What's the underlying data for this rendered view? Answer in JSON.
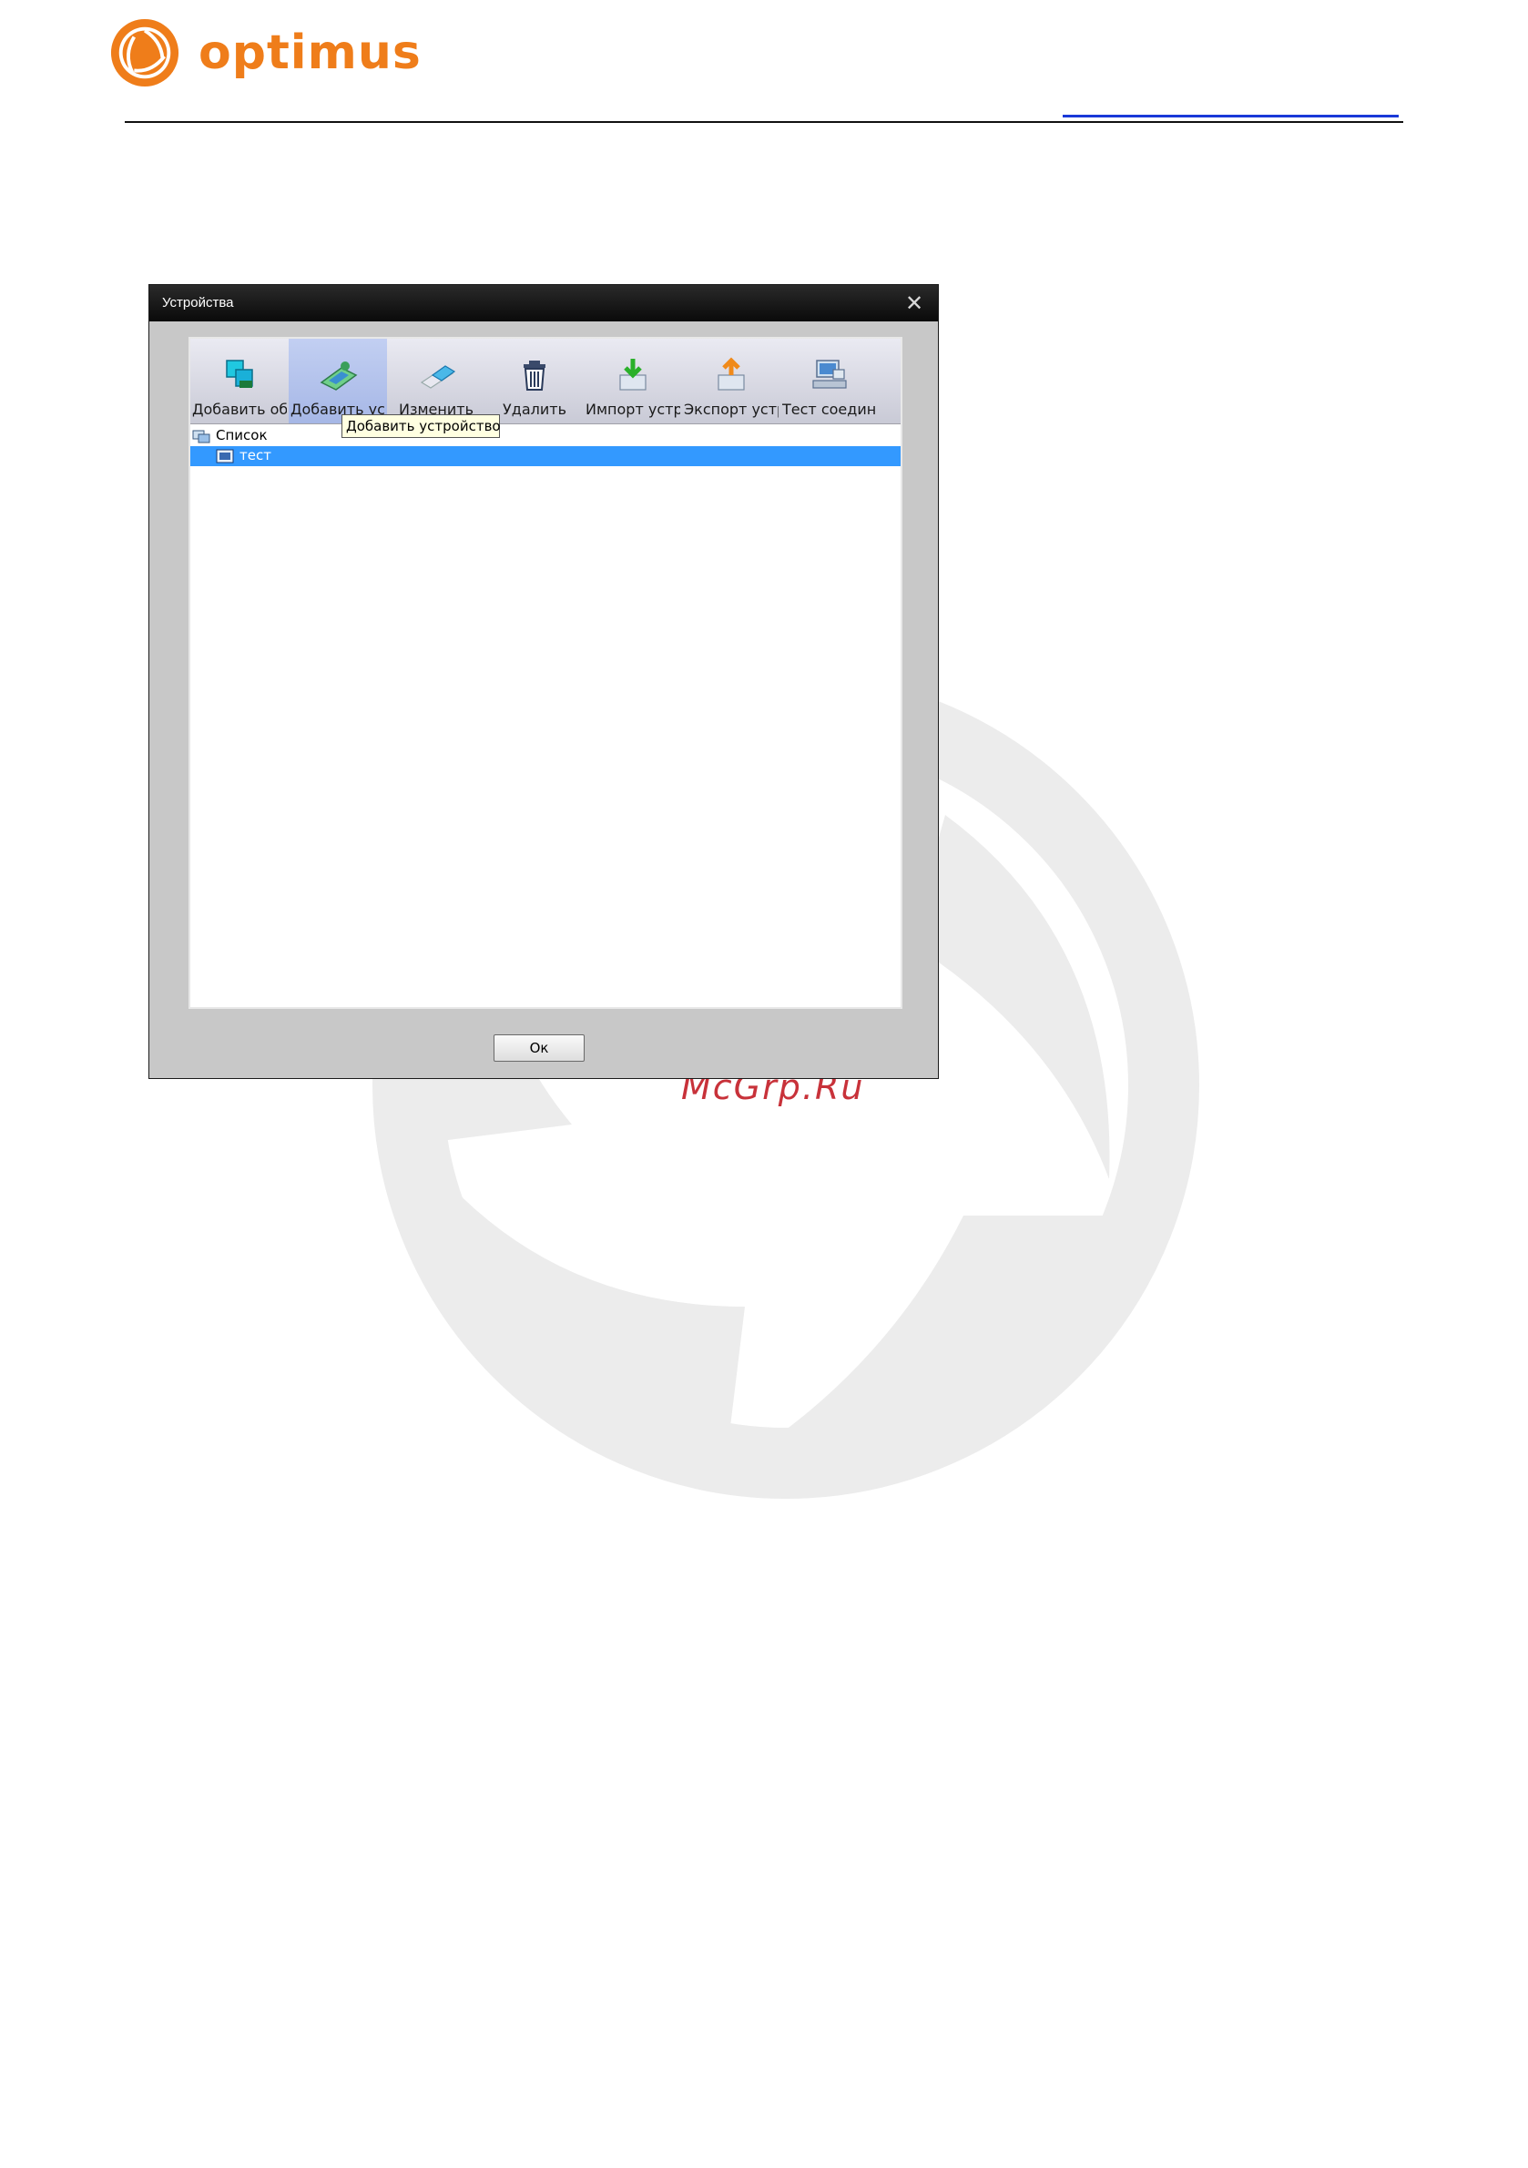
{
  "header": {
    "brand_name": "optimus",
    "brand_color": "#ef7d1a",
    "logo_icon": "aperture-logo-icon"
  },
  "watermark": {
    "text": "McGrp.Ru",
    "icon": "aperture-watermark-icon"
  },
  "dialog": {
    "title": "Устройства",
    "close_icon": "close-icon",
    "toolbar": {
      "buttons": [
        {
          "label": "Добавить обл",
          "icon": "add-area-icon"
        },
        {
          "label": "Добавить устр",
          "icon": "add-device-icon",
          "active": true
        },
        {
          "label": "Изменить",
          "icon": "edit-icon"
        },
        {
          "label": "Удалить",
          "icon": "trash-icon"
        },
        {
          "label": "Импорт устро",
          "icon": "import-icon"
        },
        {
          "label": "Экспорт устр",
          "icon": "export-icon"
        },
        {
          "label": "Тест соединени",
          "icon": "test-connection-icon"
        }
      ],
      "tooltip": "Добавить устройство"
    },
    "tree": {
      "root_label": "Список",
      "items": [
        {
          "label": "тест",
          "selected": true
        }
      ]
    },
    "ok_label": "Ок",
    "selection_color": "#3399ff"
  }
}
